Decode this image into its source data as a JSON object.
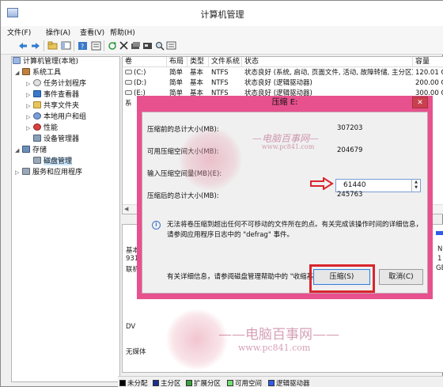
{
  "window": {
    "title": "计算机管理"
  },
  "menu": [
    "文件(F)",
    "操作(A)",
    "查看(V)",
    "帮助(H)"
  ],
  "tree": {
    "root": "计算机管理(本地)",
    "system_tools": "系统工具",
    "task_scheduler": "任务计划程序",
    "event_viewer": "事件查看器",
    "shared_folders": "共享文件夹",
    "local_users": "本地用户和组",
    "performance": "性能",
    "device_manager": "设备管理器",
    "storage": "存储",
    "disk_management": "磁盘管理",
    "services": "服务和应用程序"
  },
  "volumes": {
    "headers": [
      "卷",
      "布局",
      "类型",
      "文件系统",
      "状态",
      "容量"
    ],
    "rows": [
      [
        "(C:)",
        "简单",
        "基本",
        "NTFS",
        "状态良好 (系统, 启动, 页面文件, 活动, 故障转储, 主分区)",
        "120.01 G"
      ],
      [
        "(D:)",
        "简单",
        "基本",
        "NTFS",
        "状态良好 (逻辑驱动器)",
        "200.00 G"
      ],
      [
        "(E:)",
        "简单",
        "基本",
        "NTFS",
        "状态良好 (逻辑驱动器)",
        "300.00 G"
      ]
    ],
    "partial_row": "系"
  },
  "disk_panel": {
    "basic": "基本",
    "size": "931",
    "status": "联机",
    "dvd": "DV",
    "no_media": "无媒体",
    "right_col": [
      "N",
      "1",
      "GE"
    ]
  },
  "legend": [
    {
      "label": "未分配",
      "color": "#000000"
    },
    {
      "label": "主分区",
      "color": "#1a2f8c"
    },
    {
      "label": "扩展分区",
      "color": "#3aa23a"
    },
    {
      "label": "可用空间",
      "color": "#70e070"
    },
    {
      "label": "逻辑驱动器",
      "color": "#2f5ce8"
    }
  ],
  "dialog": {
    "title": "压缩 E:",
    "close": "✕",
    "total_before_label": "压缩前的总计大小(MB):",
    "total_before_value": "307203",
    "available_label": "可用压缩空间大小(MB):",
    "available_value": "204679",
    "input_label": "输入压缩空间量(MB)(E):",
    "input_value": "61440",
    "total_after_label": "压缩后的总计大小(MB):",
    "total_after_value": "245763",
    "info": "无法将卷压缩到超出任何不可移动的文件所在的点。有关完成该操作时间的详细信息，请参阅应用程序日志中的 \"defrag\" 事件。",
    "help": "有关详细信息，请参阅磁盘管理帮助中的 \"收缩基本卷\"",
    "shrink_button": "压缩(S)",
    "cancel_button": "取消(C)"
  },
  "watermark": {
    "top": "—电脑百事网—",
    "top_url": "www.pc841.com",
    "bottom": "——电脑百事网——",
    "bottom_url": "www.pc841.com"
  }
}
